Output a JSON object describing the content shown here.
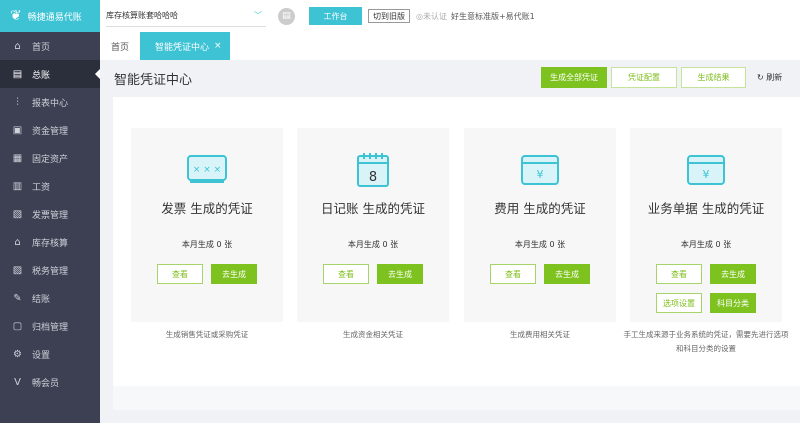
{
  "app": {
    "logo_text": "畅捷通易代账"
  },
  "sidebar": {
    "items": [
      {
        "label": "首页",
        "icon": "⌂"
      },
      {
        "label": "总账",
        "icon": "▤",
        "active": true
      },
      {
        "label": "报表中心",
        "icon": "⫶"
      },
      {
        "label": "资金管理",
        "icon": "▣"
      },
      {
        "label": "固定资产",
        "icon": "▦"
      },
      {
        "label": "工资",
        "icon": "▥"
      },
      {
        "label": "发票管理",
        "icon": "▧"
      },
      {
        "label": "库存核算",
        "icon": "⌂"
      },
      {
        "label": "税务管理",
        "icon": "▨"
      },
      {
        "label": "结账",
        "icon": "✎"
      },
      {
        "label": "归档管理",
        "icon": "▢"
      },
      {
        "label": "设置",
        "icon": "⚙"
      },
      {
        "label": "畅会员",
        "icon": "V"
      }
    ]
  },
  "topbar": {
    "account": "库存核算账套哈哈哈",
    "workbench": "工作台",
    "old_version": "切到旧版",
    "cert": "◎未认证",
    "company": "好生意标准版+易代账1"
  },
  "tabs": [
    {
      "label": "首页"
    },
    {
      "label": "智能凭证中心",
      "close": "×"
    }
  ],
  "page": {
    "title": "智能凭证中心",
    "gen_all": "生成全部凭证",
    "config": "凭证配置",
    "result": "生成结果",
    "refresh": "刷新"
  },
  "cards": [
    {
      "title": "发票 生成的凭证",
      "count": "本月生成 0 张",
      "view": "查看",
      "gen": "去生成",
      "desc": "生成销售凭证或采购凭证"
    },
    {
      "title": "日记账 生成的凭证",
      "count": "本月生成 0 张",
      "view": "查看",
      "gen": "去生成",
      "desc": "生成资金相关凭证"
    },
    {
      "title": "费用 生成的凭证",
      "count": "本月生成 0 张",
      "view": "查看",
      "gen": "去生成",
      "desc": "生成费用相关凭证"
    },
    {
      "title": "业务单据 生成的凭证",
      "count": "本月生成 0 张",
      "view": "查看",
      "gen": "去生成",
      "opt": "选项设置",
      "subj": "科目分类",
      "desc": "手工生成来源于业务系统的凭证，需要先进行选项和科目分类的设置"
    }
  ],
  "colors": {
    "accent": "#3ec3d5",
    "green": "#7dc21e",
    "sidebar": "#3c4052"
  }
}
